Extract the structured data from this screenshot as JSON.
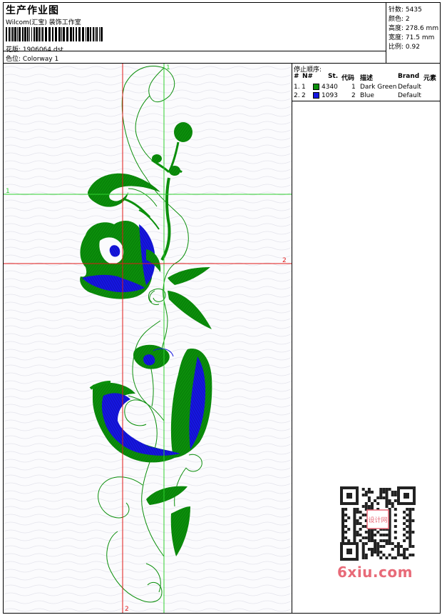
{
  "header": {
    "title": "生产作业图",
    "company": "Wilcom(汇宝) 装饰工作室",
    "design_label": "花版:",
    "design_value": "1906064.dst",
    "colorway_label": "色位:",
    "colorway_value": "Colorway 1"
  },
  "stats": [
    {
      "label": "针数:",
      "value": "5435"
    },
    {
      "label": "颜色:",
      "value": "2"
    },
    {
      "label": "高度:",
      "value": "278.6 mm"
    },
    {
      "label": "宽度:",
      "value": "71.5 mm"
    },
    {
      "label": "比例:",
      "value": "0.92"
    }
  ],
  "stop_sequence": {
    "heading": "停止顺序:",
    "columns": [
      "#",
      "N#",
      "St.",
      "代码",
      "描述",
      "Brand",
      "元素"
    ],
    "rows": [
      {
        "index": "1.",
        "n": "1",
        "stitches": "4340",
        "code": "1",
        "description": "Dark Green",
        "brand": "Default",
        "color": "#0b8f0b"
      },
      {
        "index": "2.",
        "n": "2",
        "stitches": "1093",
        "code": "2",
        "description": "Blue",
        "brand": "Default",
        "color": "#1616e0"
      }
    ]
  },
  "guides": {
    "horizontal_green": "1",
    "horizontal_red": "2",
    "vertical_green": "1",
    "vertical_red": "2"
  },
  "colors": {
    "green_thread": "#0b8f0b",
    "blue_thread": "#1616e0",
    "guide_green": "#2fd02f",
    "guide_red": "#e01818",
    "watermark": "#e86a78"
  },
  "watermark": {
    "qr_badge": "设计网",
    "brand": "6xiu.com"
  }
}
